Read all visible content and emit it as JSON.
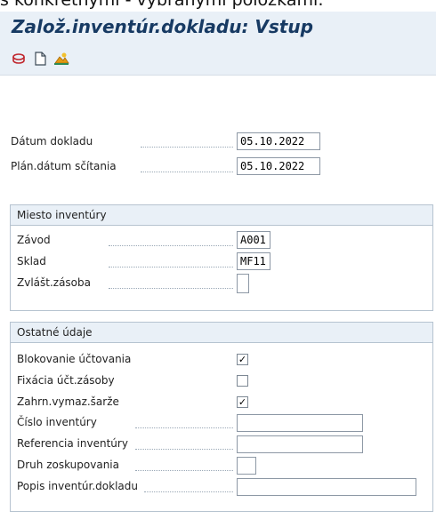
{
  "header_crop_text": "s konkrétnymi - vybranými položkami:",
  "window": {
    "title": "Založ.inventúr.dokladu: Vstup"
  },
  "toolbar": {
    "icons": [
      "display-icon",
      "new-document-icon",
      "other-icon"
    ]
  },
  "fields": {
    "datum_dokladu": {
      "label": "Dátum dokladu",
      "value": "05.10.2022"
    },
    "plan_datum": {
      "label": "Plán.dátum sčítania",
      "value": "05.10.2022"
    }
  },
  "group_miesto": {
    "title": "Miesto inventúry",
    "zavod": {
      "label": "Závod",
      "value": "A001"
    },
    "sklad": {
      "label": "Sklad",
      "value": "MF11"
    },
    "zvlast": {
      "label": "Zvlášt.zásoba",
      "value": ""
    }
  },
  "group_ostatne": {
    "title": "Ostatné údaje",
    "blokovanie": {
      "label": "Blokovanie účtovania",
      "checked": true
    },
    "fixacia": {
      "label": "Fixácia účt.zásoby",
      "checked": false
    },
    "zahrn": {
      "label": "Zahrn.vymaz.šarže",
      "checked": true
    },
    "cislo": {
      "label": "Číslo inventúry",
      "value": ""
    },
    "referencia": {
      "label": "Referencia inventúry",
      "value": ""
    },
    "druh": {
      "label": "Druh zoskupovania",
      "value": ""
    },
    "popis": {
      "label": "Popis inventúr.dokladu",
      "value": ""
    }
  },
  "colors": {
    "header_bg": "#e9f0f7",
    "title_text": "#173a63",
    "border": "#b6c3d0"
  }
}
